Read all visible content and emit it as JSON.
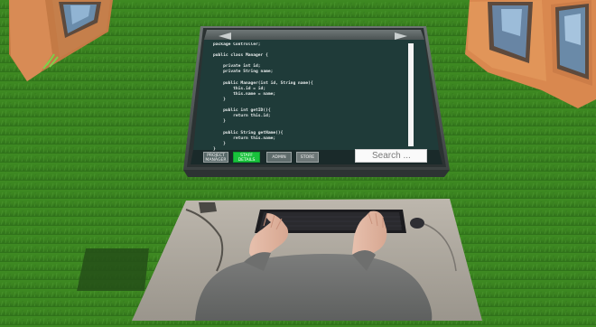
{
  "code": {
    "lines": [
      "package Controller;",
      "",
      "public class Manager {",
      "",
      "    private int id;",
      "    private String name;",
      "",
      "    public Manager(int id, String name){",
      "        this.id = id;",
      "        this.name = name;",
      "    }",
      "",
      "    public int getID(){",
      "        return this.id;",
      "    }",
      "",
      "    public String getName(){",
      "        return this.name;",
      "    }",
      "}"
    ]
  },
  "toolbar": {
    "project_label_1": "PROJECT",
    "project_label_2": "MANAGER",
    "staff_label_1": "STAFF",
    "staff_label_2": "DETAILS",
    "admin_label": "ADMIN",
    "store_label": "STORE"
  },
  "search": {
    "placeholder": "Search ..."
  },
  "colors": {
    "grass": "#3f8a22",
    "screen": "#1f3b39",
    "active_button": "#19c23c",
    "house_wall": "#d98a55"
  }
}
